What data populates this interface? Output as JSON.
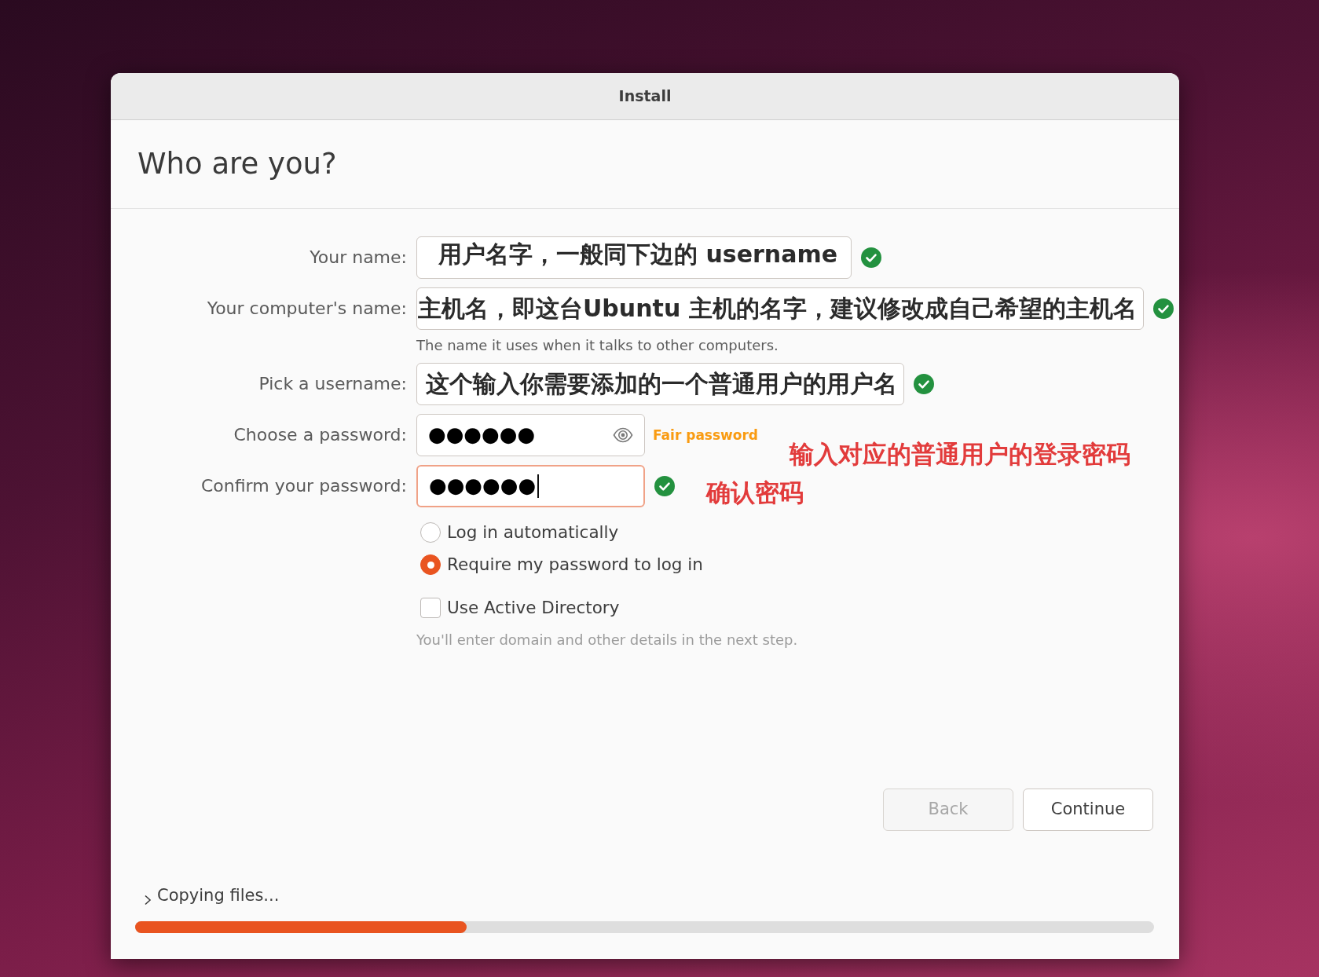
{
  "window": {
    "title": "Install"
  },
  "header": {
    "title": "Who are you?"
  },
  "form": {
    "rows": [
      {
        "kind": "text",
        "label": "Your name:",
        "focused": false,
        "valid": true,
        "annotation": {
          "kind": "overlay",
          "text": "用户名字，一般同下边的 username"
        }
      },
      {
        "kind": "text",
        "label": "Your computer's name:",
        "focused": false,
        "valid": true,
        "hint": "The name it uses when it talks to other computers.",
        "annotation": {
          "kind": "overlay",
          "text": "主机名，即这台Ubuntu 主机的名字，建议修改成自己希望的主机名"
        }
      },
      {
        "kind": "text",
        "label": "Pick a username:",
        "focused": false,
        "valid": true,
        "annotation": {
          "kind": "overlay",
          "text": "这个输入你需要添加的一个普通用户的用户名"
        }
      },
      {
        "kind": "password",
        "label": "Choose a password:",
        "value": "●●●●●●",
        "focused": false,
        "valid": false,
        "strength": "Fair password",
        "annotation": {
          "kind": "note",
          "text": "输入对应的普通用户的登录密码"
        }
      },
      {
        "kind": "confirm",
        "label": "Confirm your password:",
        "value": "●●●●●●",
        "focused": true,
        "valid": true,
        "annotation": {
          "kind": "note",
          "text": "确认密码"
        }
      }
    ],
    "login_options": [
      {
        "label": "Log in automatically",
        "selected": false
      },
      {
        "label": "Require my password to log in",
        "selected": true
      }
    ],
    "active_directory": {
      "label": "Use Active Directory",
      "checked": false,
      "hint": "You'll enter domain and other details in the next step."
    }
  },
  "buttons": [
    {
      "label": "Back",
      "disabled": true
    },
    {
      "label": "Continue",
      "disabled": false
    }
  ],
  "progress": {
    "label": "Copying files...",
    "expanded": false,
    "level": 0.325
  }
}
